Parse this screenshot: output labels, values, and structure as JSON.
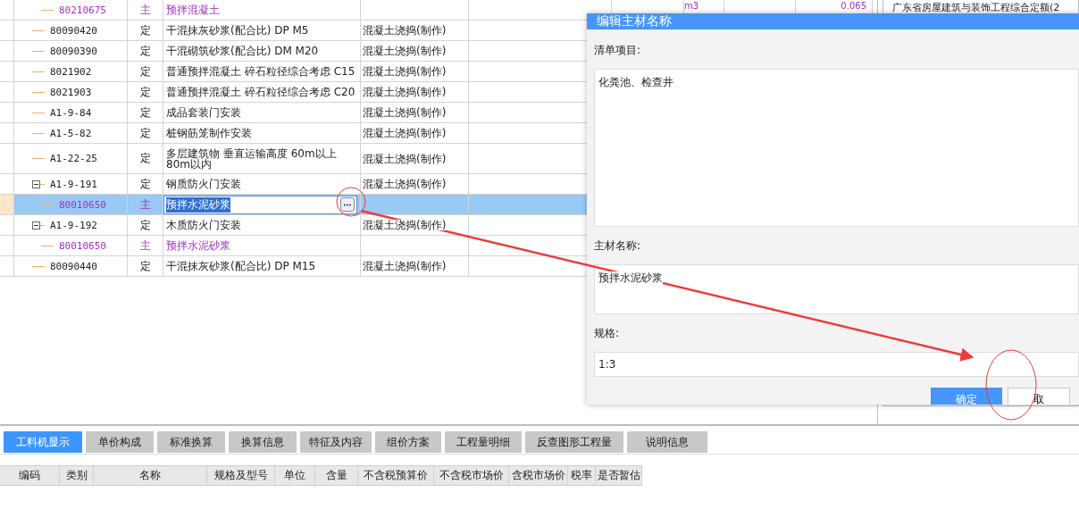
{
  "grid": {
    "rows": [
      {
        "code": "80210675",
        "type": "主",
        "kind": "main",
        "name": "预拌混凝土",
        "unit": "m3",
        "quantity": "0.065"
      },
      {
        "code": "80090420",
        "type": "定",
        "kind": "quota",
        "name": "干混抹灰砂浆(配合比) DP M5",
        "content": "混凝土浇捣(制作)"
      },
      {
        "code": "80090390",
        "type": "定",
        "kind": "quota",
        "name": "干混砌筑砂浆(配合比) DM M20",
        "content": "混凝土浇捣(制作)"
      },
      {
        "code": "8021902",
        "type": "定",
        "kind": "quota",
        "name": "普通预拌混凝土 碎石粒径综合考虑 C15",
        "content": "混凝土浇捣(制作)"
      },
      {
        "code": "8021903",
        "type": "定",
        "kind": "quota",
        "name": "普通预拌混凝土 碎石粒径综合考虑 C20",
        "content": "混凝土浇捣(制作)"
      },
      {
        "code": "A1-9-84",
        "type": "定",
        "kind": "quota",
        "name": "成品套装门安装",
        "content": "混凝土浇捣(制作)"
      },
      {
        "code": "A1-5-82",
        "type": "定",
        "kind": "quota",
        "name": "桩钢筋笼制作安装",
        "content": "混凝土浇捣(制作)"
      },
      {
        "code": "A1-22-25",
        "type": "定",
        "kind": "quota",
        "name": "多层建筑物 垂直运输高度 60m以上80m以内",
        "content": "混凝土浇捣(制作)"
      },
      {
        "code": "A1-9-191",
        "type": "定",
        "kind": "quota",
        "name": "钢质防火门安装",
        "content": "混凝土浇捣(制作)",
        "expanded": true,
        "children": [
          {
            "code": "80010650",
            "type": "主",
            "kind": "main",
            "name": "预拌水泥砂浆",
            "selected": true
          }
        ]
      },
      {
        "code": "A1-9-192",
        "type": "定",
        "kind": "quota",
        "name": "木质防火门安装",
        "content": "混凝土浇捣(制作)",
        "expanded": true,
        "children": [
          {
            "code": "80010650",
            "type": "主",
            "kind": "main",
            "name": "预拌水泥砂浆",
            "selected": false
          }
        ]
      },
      {
        "code": "80090440",
        "type": "定",
        "kind": "quota",
        "name": "干混抹灰砂浆(配合比) DP M15",
        "content": "混凝土浇捣(制作)"
      }
    ]
  },
  "side_panel": {
    "title": "广东省房屋建筑与装饰工程综合定额(2"
  },
  "dialog": {
    "title": "编辑主材名称",
    "fields": [
      {
        "label": "清单项目:",
        "value": "化粪池、检查井",
        "kind": "tall"
      },
      {
        "label": "主材名称:",
        "value": "预拌水泥砂浆",
        "kind": "medium"
      },
      {
        "label": "规格:",
        "value": "1:3",
        "kind": "short"
      }
    ],
    "buttons": [
      {
        "label": "确定",
        "primary": true
      },
      {
        "label": "取",
        "primary": false
      }
    ]
  },
  "bottom_tabs": [
    {
      "label": "工料机显示",
      "selected": true
    },
    {
      "label": "单价构成",
      "selected": false
    },
    {
      "label": "标准换算",
      "selected": false
    },
    {
      "label": "换算信息",
      "selected": false
    },
    {
      "label": "特征及内容",
      "selected": false
    },
    {
      "label": "组价方案",
      "selected": false
    },
    {
      "label": "工程量明细",
      "selected": false
    },
    {
      "label": "反查图形工程量",
      "selected": false
    },
    {
      "label": "说明信息",
      "selected": false
    }
  ],
  "detail_table": {
    "columns": [
      "编码",
      "类别",
      "名称",
      "规格及型号",
      "单位",
      "含量",
      "不含税预算价",
      "不含税市场价",
      "含税市场价",
      "税率",
      "是否暂估"
    ]
  }
}
